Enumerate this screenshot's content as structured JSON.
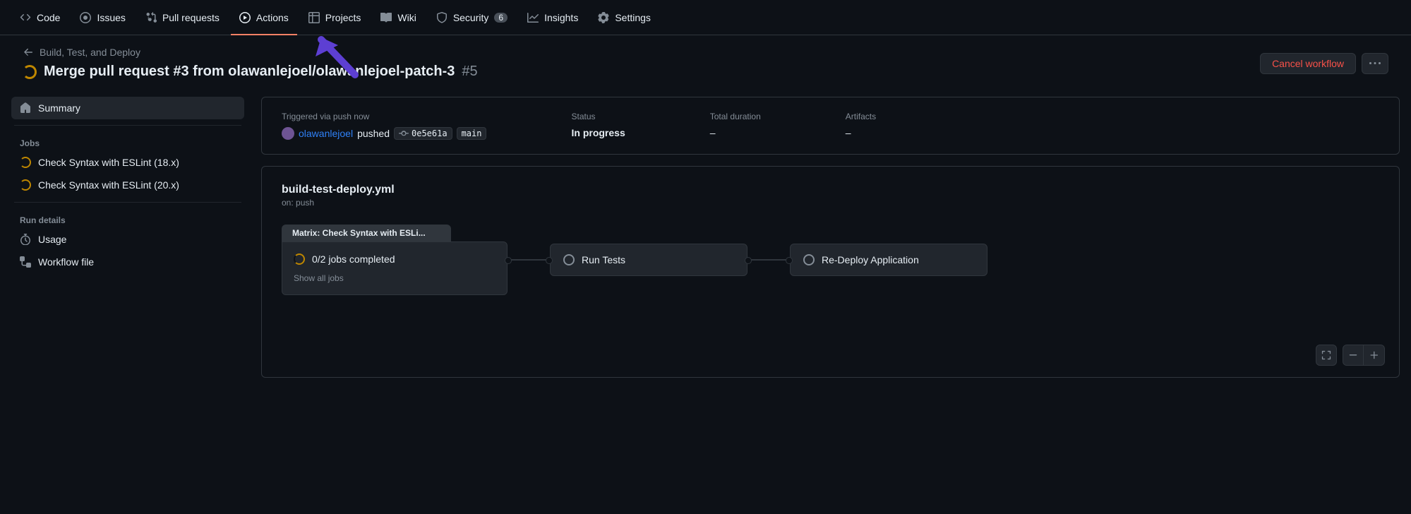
{
  "nav": {
    "code": "Code",
    "issues": "Issues",
    "pulls": "Pull requests",
    "actions": "Actions",
    "projects": "Projects",
    "wiki": "Wiki",
    "security": "Security",
    "security_count": "6",
    "insights": "Insights",
    "settings": "Settings"
  },
  "breadcrumb": {
    "parent": "Build, Test, and Deploy"
  },
  "run": {
    "title": "Merge pull request #3 from olawanlejoel/olawanlejoel-patch-3",
    "number": "#5",
    "cancel": "Cancel workflow"
  },
  "sidebar": {
    "summary": "Summary",
    "jobs_heading": "Jobs",
    "job1": "Check Syntax with ESLint (18.x)",
    "job2": "Check Syntax with ESLint (20.x)",
    "run_details_heading": "Run details",
    "usage": "Usage",
    "workflow_file": "Workflow file"
  },
  "summary": {
    "triggered_label": "Triggered via push now",
    "actor": "olawanlejoel",
    "pushed": "pushed",
    "sha": "0e5e61a",
    "branch": "main",
    "status_label": "Status",
    "status_value": "In progress",
    "duration_label": "Total duration",
    "duration_value": "–",
    "artifacts_label": "Artifacts",
    "artifacts_value": "–"
  },
  "workflow": {
    "file": "build-test-deploy.yml",
    "on": "on: push",
    "matrix_label": "Matrix: Check Syntax with ESLi...",
    "matrix_progress": "0/2 jobs completed",
    "show_all": "Show all jobs",
    "job_tests": "Run Tests",
    "job_deploy": "Re-Deploy Application"
  }
}
